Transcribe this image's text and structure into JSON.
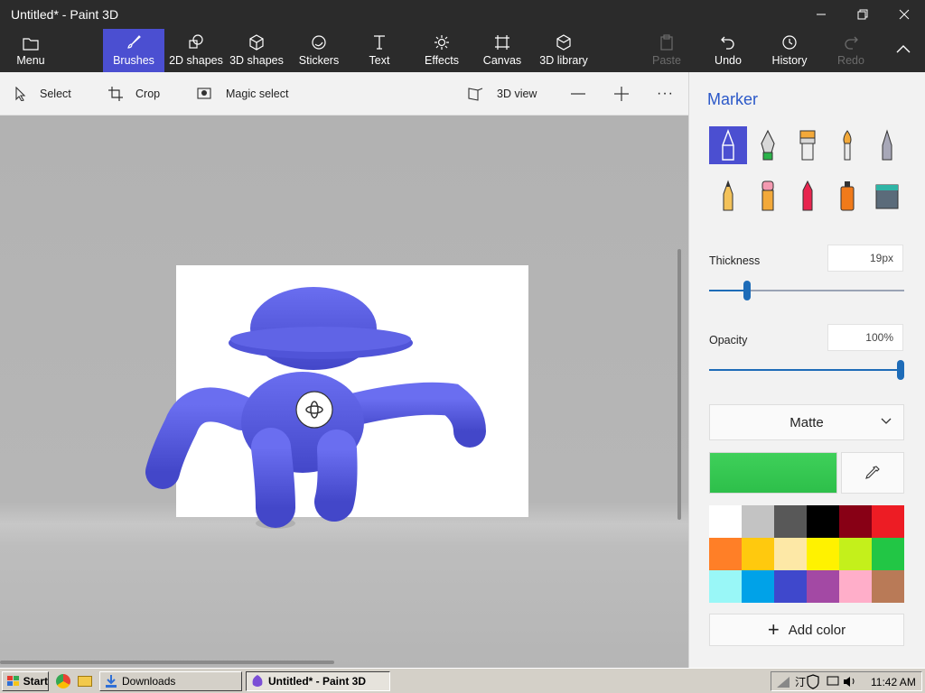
{
  "window": {
    "title": "Untitled* - Paint 3D",
    "controls": [
      "minimize-icon",
      "restore-icon",
      "close-icon"
    ]
  },
  "ribbon": {
    "menu": "Menu",
    "tabs": [
      "Brushes",
      "2D shapes",
      "3D shapes",
      "Stickers",
      "Text",
      "Effects",
      "Canvas",
      "3D library"
    ],
    "active_tab": "Brushes",
    "actions": {
      "paste": "Paste",
      "undo": "Undo",
      "history": "History",
      "redo": "Redo"
    }
  },
  "subtoolbar": {
    "select": "Select",
    "crop": "Crop",
    "magic_select": "Magic select",
    "view3d": "3D view",
    "more": "···"
  },
  "panel": {
    "title": "Marker",
    "tools": [
      "marker-icon",
      "calligraphy-pen-icon",
      "oil-brush-icon",
      "watercolor-icon",
      "pixel-pen-icon",
      "pencil-icon",
      "eraser-icon",
      "crayon-icon",
      "spray-can-icon",
      "fill-icon"
    ],
    "selected_tool": 0,
    "thickness_label": "Thickness",
    "thickness_value": "19px",
    "thickness_level": 0.19,
    "opacity_label": "Opacity",
    "opacity_value": "100%",
    "opacity_level": 1.0,
    "finish": "Matte",
    "current_color": "#2dbf4a",
    "palette": [
      "#ffffff",
      "#c3c3c3",
      "#585858",
      "#000000",
      "#880015",
      "#ed1c24",
      "#ff7f27",
      "#ffc90e",
      "#fde8a6",
      "#fff200",
      "#c4f01b",
      "#22c645",
      "#99f7f7",
      "#00a2e8",
      "#3f48cc",
      "#a349a4",
      "#ffaec9",
      "#b97a57"
    ],
    "add_color": "Add color"
  },
  "taskbar": {
    "start": "Start",
    "downloads": "Downloads",
    "active_window": "Untitled* - Paint 3D",
    "clock": "11:42 AM"
  },
  "colors": {
    "accent": "#4b4fd1",
    "figure": "#5458e0",
    "panel_title": "#2b58c8"
  }
}
